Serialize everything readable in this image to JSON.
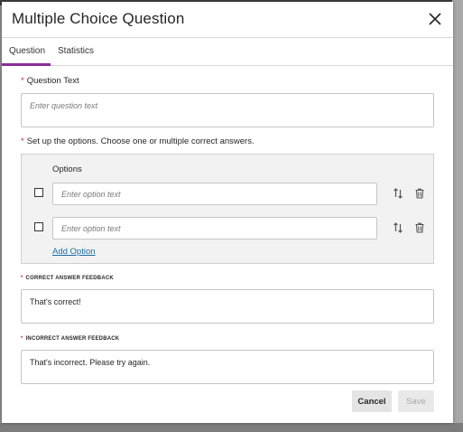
{
  "dialog": {
    "title": "Multiple Choice Question",
    "close_icon": "close-icon"
  },
  "tabs": [
    {
      "label": "Question",
      "active": true
    },
    {
      "label": "Statistics",
      "active": false
    }
  ],
  "question_text": {
    "label": "Question Text",
    "placeholder": "Enter question text",
    "required": true
  },
  "options_section": {
    "instructions": "Set up the options. Choose one or multiple correct answers.",
    "title": "Options",
    "options": [
      {
        "placeholder": "Enter option text",
        "checked": false,
        "reorder_icon": "reorder-icon",
        "delete_icon": "trash-icon"
      },
      {
        "placeholder": "Enter option text",
        "checked": false,
        "reorder_icon": "reorder-icon",
        "delete_icon": "trash-icon"
      }
    ],
    "add_option_label": "Add Option"
  },
  "correct_feedback": {
    "label": "CORRECT ANSWER FEEDBACK",
    "value": "That's correct!"
  },
  "incorrect_feedback": {
    "label": "INCORRECT ANSWER FEEDBACK",
    "value": "That's incorrect. Please try again."
  },
  "footer": {
    "cancel_label": "Cancel",
    "save_label": "Save",
    "save_enabled": false
  },
  "colors": {
    "accent": "#8b2d9a",
    "required": "#c4352b",
    "link": "#1b6ea8"
  }
}
